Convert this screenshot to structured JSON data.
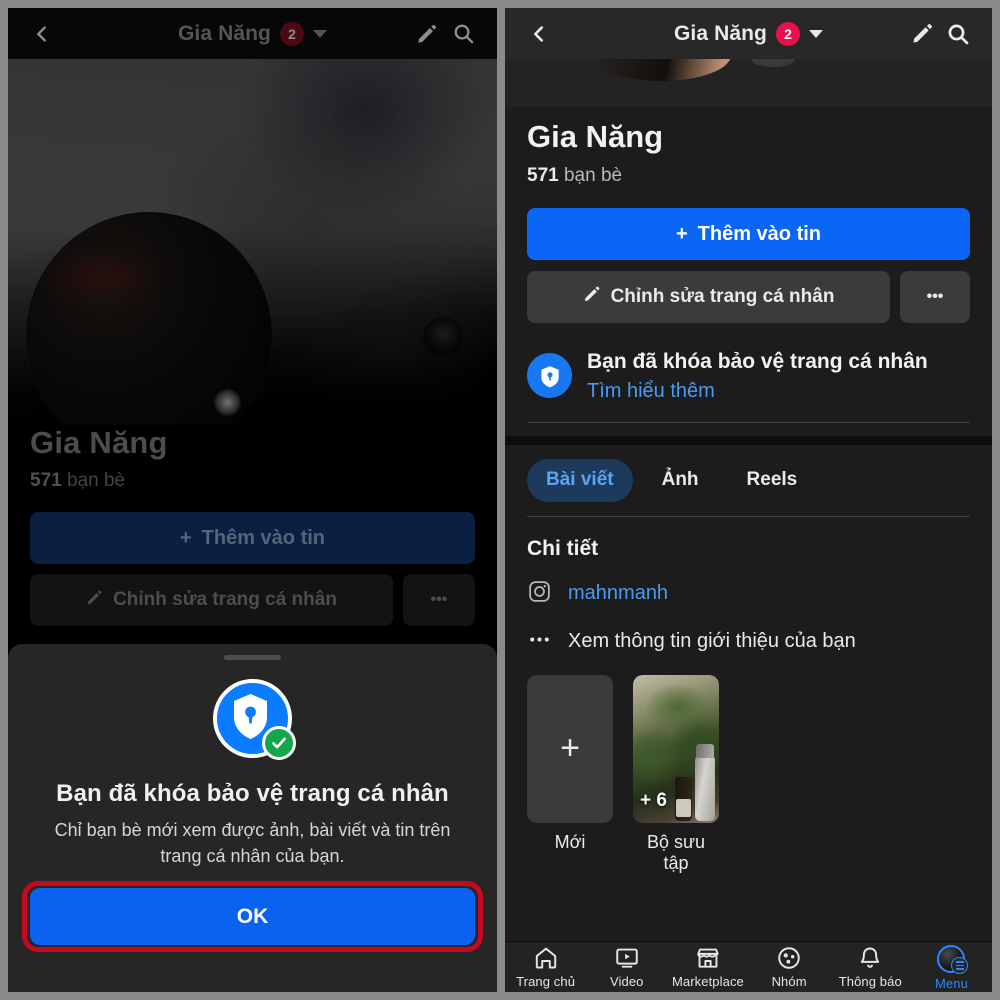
{
  "app": {
    "name": "Facebook",
    "platform": "mobile",
    "theme": "dark"
  },
  "colors": {
    "accent_blue": "#0b66f5",
    "link_blue": "#4a9bf5",
    "badge_red": "#e8114b",
    "annotation_red": "#c30a22",
    "green_check": "#16a64a",
    "surface": "#1c1c1c",
    "surface_raised": "#3a3b3c",
    "sheet_bg": "#262626"
  },
  "appbar": {
    "title": "Gia Năng",
    "notification_count": "2",
    "back_icon": "chevron-left-icon",
    "dropdown_icon": "chevron-down-icon",
    "edit_icon": "pencil-icon",
    "search_icon": "search-icon"
  },
  "left_panel": {
    "cover_photo_alt": "blurred cover photo",
    "avatar_alt": "profile avatar",
    "profile": {
      "name": "Gia Năng",
      "friends_count": "571",
      "friends_label": "bạn bè",
      "add_story_label": "Thêm vào tin",
      "add_story_icon": "plus-icon",
      "edit_profile_label": "Chỉnh sửa trang cá nhân",
      "edit_profile_icon": "pencil-icon",
      "more_label": "•••"
    },
    "modal": {
      "handle": "drag-handle",
      "icon": "shield-lock-icon",
      "check_icon": "check-icon",
      "title": "Bạn đã khóa bảo vệ trang cá nhân",
      "description": "Chỉ bạn bè mới xem được ảnh, bài viết và tin trên trang cá nhân của bạn.",
      "ok_label": "OK",
      "annotation": "red-highlight-outline"
    }
  },
  "right_panel": {
    "profile": {
      "name": "Gia Năng",
      "friends_count": "571",
      "friends_label": "bạn bè",
      "add_story_label": "Thêm vào tin",
      "add_story_icon": "plus-icon",
      "edit_profile_label": "Chỉnh sửa trang cá nhân",
      "edit_profile_icon": "pencil-icon",
      "more_label": "•••"
    },
    "lock_banner": {
      "icon": "shield-lock-icon",
      "title": "Bạn đã khóa bảo vệ trang cá nhân",
      "link_label": "Tìm hiểu thêm"
    },
    "tabs": [
      {
        "label": "Bài viết",
        "active": true
      },
      {
        "label": "Ảnh",
        "active": false
      },
      {
        "label": "Reels",
        "active": false
      }
    ],
    "details": {
      "heading": "Chi tiết",
      "rows": [
        {
          "icon": "instagram-icon",
          "label": "mahnmanh",
          "is_link": true
        },
        {
          "icon": "ellipsis-icon",
          "label": "Xem thông tin giới thiệu của bạn",
          "is_link": false
        }
      ]
    },
    "cards": [
      {
        "label": "Mới",
        "type": "add",
        "icon": "plus-icon"
      },
      {
        "label": "Bộ sưu tập",
        "type": "photo",
        "overlay_count": "+ 6",
        "photo_alt": "potted plants photo"
      }
    ],
    "bottom_nav": [
      {
        "label": "Trang chủ",
        "icon": "home-icon",
        "active": false
      },
      {
        "label": "Video",
        "icon": "video-icon",
        "active": false
      },
      {
        "label": "Marketplace",
        "icon": "marketplace-icon",
        "active": false
      },
      {
        "label": "Nhóm",
        "icon": "groups-icon",
        "active": false
      },
      {
        "label": "Thông báo",
        "icon": "bell-icon",
        "active": false
      },
      {
        "label": "Menu",
        "icon": "menu-avatar-icon",
        "active": true
      }
    ]
  }
}
